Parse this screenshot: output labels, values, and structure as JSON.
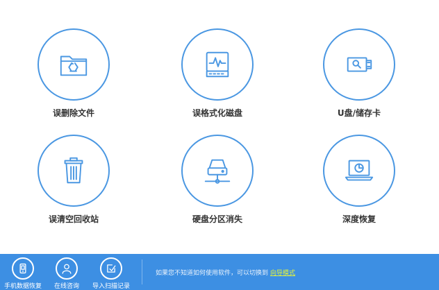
{
  "tiles": [
    {
      "label": "误删除文件",
      "icon": "recycle-folder-icon"
    },
    {
      "label": "误格式化磁盘",
      "icon": "formatted-disk-icon"
    },
    {
      "label": "U盘/储存卡",
      "icon": "usb-drive-icon"
    },
    {
      "label": "误清空回收站",
      "icon": "trash-can-icon"
    },
    {
      "label": "硬盘分区消失",
      "icon": "hard-drive-partition-icon"
    },
    {
      "label": "深度恢复",
      "icon": "deep-recovery-laptop-icon"
    }
  ],
  "footer": {
    "buttons": [
      {
        "label": "手机数据恢复",
        "icon": "phone-icon"
      },
      {
        "label": "在线咨询",
        "icon": "person-icon"
      },
      {
        "label": "导入扫描记录",
        "icon": "import-record-icon"
      }
    ],
    "hint": "如果您不知道如何使用软件，可以切换到",
    "link": "向导模式"
  },
  "colors": {
    "accent": "#4a97e2",
    "footer_bg": "#3d8fe3",
    "link": "#e4f23c",
    "tile_label": "#333333"
  }
}
